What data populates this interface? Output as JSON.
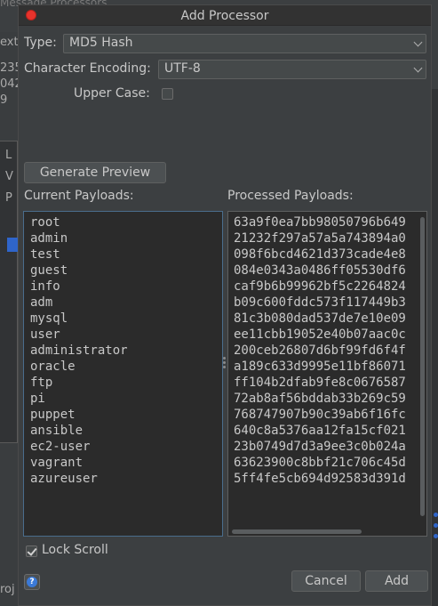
{
  "background": {
    "top_text": "Message Processors",
    "fragments": [
      "ext",
      "235",
      "042",
      "9"
    ],
    "left_letters": [
      "L",
      "V",
      "P"
    ],
    "bottom_text": "roj"
  },
  "dialog": {
    "title": "Add Processor",
    "type_label": "Type:",
    "type_value": "MD5 Hash",
    "encoding_label": "Character Encoding:",
    "encoding_value": "UTF-8",
    "uppercase_label": "Upper Case:",
    "uppercase_checked": false,
    "generate_preview_label": "Generate Preview",
    "current_payloads_label": "Current Payloads:",
    "processed_payloads_label": "Processed Payloads:",
    "current_payloads": [
      "root",
      "admin",
      "test",
      "guest",
      "info",
      "adm",
      "mysql",
      "user",
      "administrator",
      "oracle",
      "ftp",
      "pi",
      "puppet",
      "ansible",
      "ec2-user",
      "vagrant",
      "azureuser"
    ],
    "processed_payloads": [
      "63a9f0ea7bb98050796b649",
      "21232f297a57a5a743894a0",
      "098f6bcd4621d373cade4e8",
      "084e0343a0486ff05530df6",
      "caf9b6b99962bf5c2264824",
      "b09c600fddc573f117449b3",
      "81c3b080dad537de7e10e09",
      "ee11cbb19052e40b07aac0c",
      "200ceb26807d6bf99fd6f4f",
      "a189c633d9995e11bf86071",
      "ff104b2dfab9fe8c0676587",
      "72ab8af56bddab33b269c59",
      "768747907b90c39ab6f16fc",
      "640c8a5376aa12fa15cf021",
      "23b0749d7d3a9ee3c0b024a",
      "63623900c8bbf21c706c45d",
      "5ff4fe5cb694d92583d391d"
    ],
    "lock_scroll_label": "Lock Scroll",
    "lock_scroll_checked": true,
    "cancel_label": "Cancel",
    "add_label": "Add",
    "help_icon": "?"
  },
  "colors": {
    "close": "#e8332c",
    "accent": "#3b7ad8",
    "selection": "#2f65ca"
  }
}
